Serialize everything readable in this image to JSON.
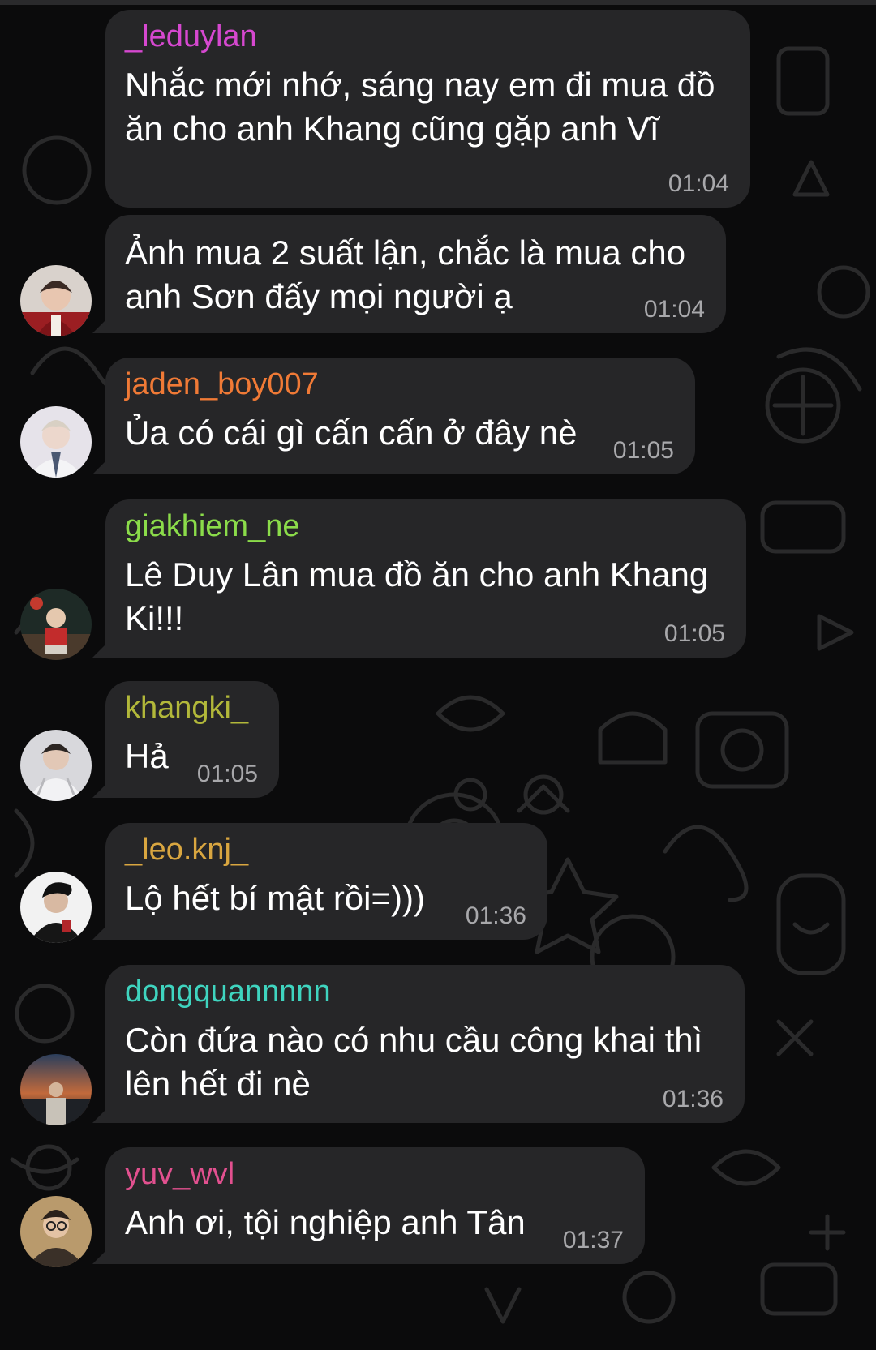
{
  "messages": [
    {
      "sender": "_leduylan",
      "text": "Nhắc mới nhớ, sáng nay em đi mua đồ\năn cho anh Khang cũng gặp anh Vĩ",
      "time": "01:04"
    },
    {
      "sender": "",
      "text": "Ảnh mua 2 suất lận, chắc là mua cho\nanh Sơn đấy mọi người ạ",
      "time": "01:04"
    },
    {
      "sender": "jaden_boy007",
      "text": "Ủa có cái gì cấn cấn ở đây nè",
      "time": "01:05"
    },
    {
      "sender": "giakhiem_ne",
      "text": "Lê Duy Lân mua đồ ăn cho anh Khang\nKi!!!",
      "time": "01:05"
    },
    {
      "sender": "khangki_",
      "text": "Hả",
      "time": "01:05"
    },
    {
      "sender": "_leo.knj_",
      "text": "Lộ hết bí mật rồi=)))",
      "time": "01:36"
    },
    {
      "sender": "dongquannnnn",
      "text": "Còn đứa nào có nhu cầu công khai thì\nlên hết đi nè",
      "time": "01:36"
    },
    {
      "sender": "yuv_wvl",
      "text": "Anh ơi, tội nghiệp anh Tân",
      "time": "01:37"
    }
  ],
  "colors": {
    "background": "#0b0b0c",
    "bubble": "#262628",
    "text": "#ffffff",
    "time": "#a8a8ab",
    "sender_leduylan": "#d648d0",
    "sender_jaden_boy007": "#f07a36",
    "sender_giakhiem_ne": "#8bdc4a",
    "sender_khangki_": "#b2b83a",
    "sender_leo_knj_": "#d9a640",
    "sender_dongquannnnn": "#3fd4bf",
    "sender_yuv_wvl": "#e2508f"
  },
  "icons": [
    "avatar-photo",
    "doodle-pattern"
  ]
}
